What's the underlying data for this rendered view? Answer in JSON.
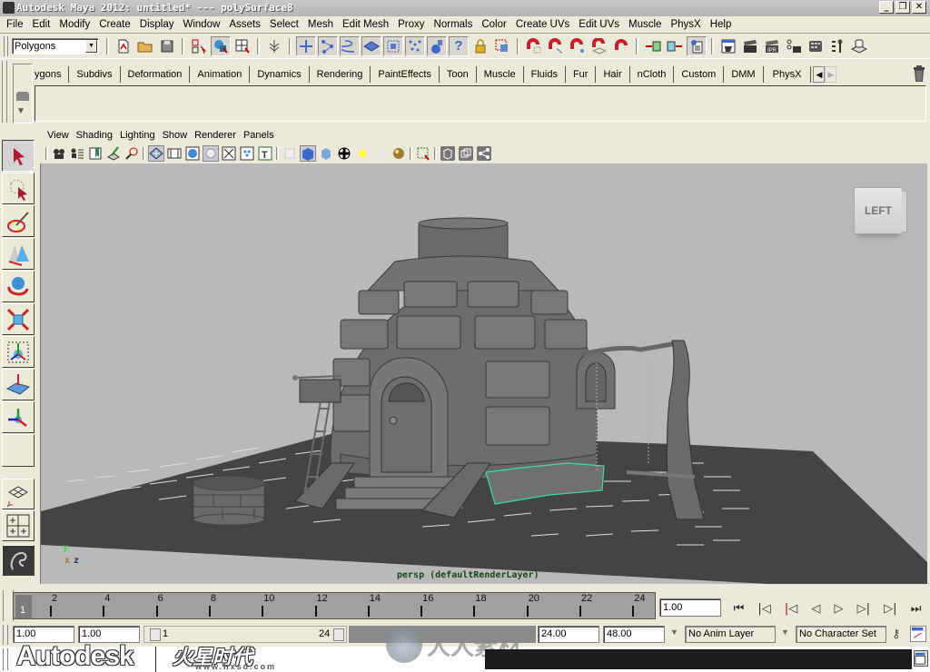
{
  "window": {
    "title": "Autodesk Maya 2012: untitled*   ---   polySurface8",
    "controls": {
      "minimize": "_",
      "restore": "❐",
      "close": "✕"
    }
  },
  "menubar": [
    "File",
    "Edit",
    "Modify",
    "Create",
    "Display",
    "Window",
    "Assets",
    "Select",
    "Mesh",
    "Edit Mesh",
    "Proxy",
    "Normals",
    "Color",
    "Create UVs",
    "Edit UVs",
    "Muscle",
    "PhysX",
    "Help"
  ],
  "status_line": {
    "menu_set": "Polygons",
    "icons": [
      "new-scene-icon",
      "open-scene-icon",
      "save-scene-icon",
      "select-hierarchy-icon",
      "select-object-icon",
      "select-component-icon",
      "lock-selection-icon",
      "select-handles-icon",
      "select-joints-icon",
      "select-curves-icon",
      "select-surfaces-icon",
      "select-deformations-icon",
      "select-dynamics-icon",
      "select-rendering-icon",
      "select-misc-icon",
      "lock-icon",
      "highlight-selection-icon",
      "snap-grid-icon",
      "snap-curve-icon",
      "snap-point-icon",
      "snap-view-plane-icon",
      "make-live-icon",
      "input-ops-icon",
      "output-ops-icon",
      "construction-history-icon",
      "render-view-icon",
      "render-icon",
      "ipr-render-icon",
      "render-settings-icon",
      "hypershade-icon",
      "attribute-editor-icon",
      "channel-box-icon"
    ]
  },
  "shelf": {
    "tabs": [
      "ygons",
      "Subdivs",
      "Deformation",
      "Animation",
      "Dynamics",
      "Rendering",
      "PaintEffects",
      "Toon",
      "Muscle",
      "Fluids",
      "Fur",
      "Hair",
      "nCloth",
      "Custom",
      "DMM",
      "PhysX"
    ],
    "active_tab": "PhysX"
  },
  "panel": {
    "menu": [
      "View",
      "Shading",
      "Lighting",
      "Show",
      "Renderer",
      "Panels"
    ],
    "camera_label": "persp (defaultRenderLayer)",
    "viewcube_label": "LEFT",
    "axis": {
      "y": "y",
      "x": "x",
      "z": "z"
    }
  },
  "toolbox": [
    "select-tool",
    "lasso-tool",
    "paint-select-tool",
    "move-tool",
    "rotate-tool",
    "scale-tool",
    "universal-manipulator",
    "soft-modification-tool",
    "show-manipulator-tool"
  ],
  "timeline": {
    "ticks": [
      "2",
      "4",
      "6",
      "8",
      "10",
      "12",
      "14",
      "16",
      "18",
      "20",
      "22",
      "24"
    ],
    "current_frame_label": "1",
    "current_time": "1.00",
    "playback_buttons": [
      "⏮",
      "|◁",
      "|◁",
      "◁",
      "▷",
      "▷|",
      "▷|",
      "⏭"
    ]
  },
  "range": {
    "start_time": "1.00",
    "playback_start": "1.00",
    "range_start": "1",
    "range_end": "24",
    "playback_end": "24.00",
    "end_time": "48.00",
    "anim_layer": "No Anim Layer",
    "character_set": "No Character Set"
  },
  "watermarks": {
    "brand": "Autodesk",
    "site": "www.hxsd.com",
    "cn_logo": "火星时代",
    "cn_site": "人人素材"
  }
}
